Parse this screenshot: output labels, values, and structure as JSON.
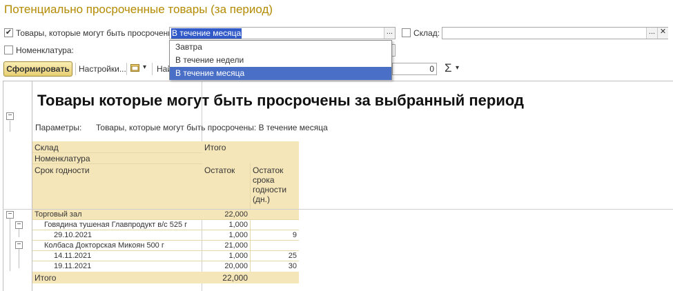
{
  "title": "Потенциально просроченные товары (за период)",
  "filters": {
    "expire_label": "Товары, которые могут быть просрочены:",
    "expire_value": "В течение месяца",
    "expire_checked": true,
    "warehouse_label": "Склад:",
    "warehouse_checked": false,
    "nomenclature_label": "Номенклатура:",
    "nomenclature_checked": false,
    "dots": "...",
    "clear": "✕",
    "check_mark": "✔"
  },
  "dropdown": {
    "items": [
      "Завтра",
      "В течение недели",
      "В течение месяца"
    ],
    "selected_index": 2
  },
  "toolbar": {
    "generate": "Сформировать",
    "settings": "Настройки...",
    "partial": "Най",
    "counter": "0",
    "sigma": "Σ",
    "arrow": "▾"
  },
  "report": {
    "heading": "Товары которые могут быть просрочены за выбранный период",
    "params_label": "Параметры:",
    "params_value": "Товары, которые могут быть просрочены: В течение месяца",
    "header": {
      "warehouse": "Склад",
      "total": "Итого",
      "nomenclature": "Номенклатура",
      "expiry": "Срок годности",
      "balance": "Остаток",
      "remaining_life": "Остаток срока годности (дн.)"
    },
    "rows": [
      {
        "name": "Торговый зал",
        "qty": "22,000",
        "days": ""
      },
      {
        "name": "Говядина тушеная Главпродукт в/с 525 г",
        "qty": "1,000",
        "days": ""
      },
      {
        "name": "29.10.2021",
        "qty": "1,000",
        "days": "9"
      },
      {
        "name": "Колбаса Докторская Микоян 500 г",
        "qty": "21,000",
        "days": ""
      },
      {
        "name": "14.11.2021",
        "qty": "1,000",
        "days": "25"
      },
      {
        "name": "19.11.2021",
        "qty": "20,000",
        "days": "30"
      }
    ],
    "total": {
      "name": "Итого",
      "qty": "22,000"
    },
    "tree_minus": "−"
  },
  "colors": {
    "title": "#b38a00",
    "header_bg": "#f5e6b9",
    "selection": "#4a6fc7"
  }
}
